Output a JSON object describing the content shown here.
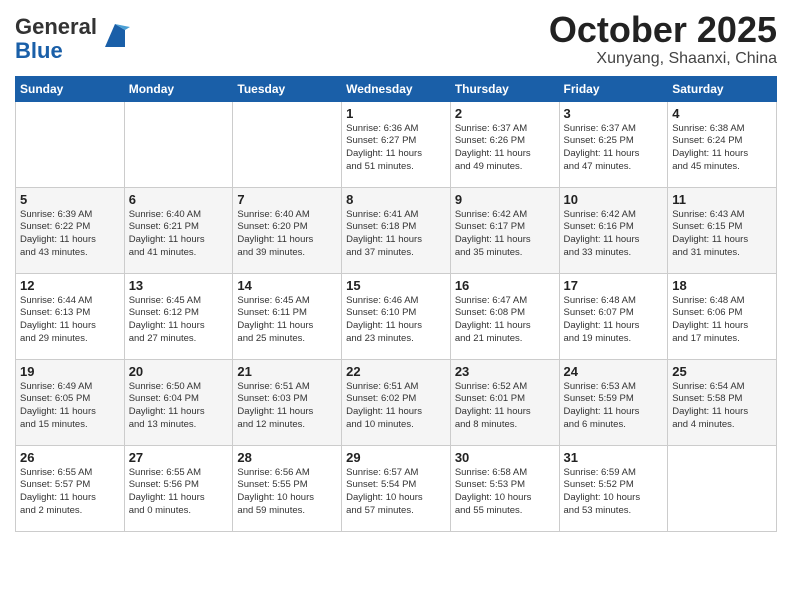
{
  "header": {
    "logo_general": "General",
    "logo_blue": "Blue",
    "month_title": "October 2025",
    "location": "Xunyang, Shaanxi, China"
  },
  "weekdays": [
    "Sunday",
    "Monday",
    "Tuesday",
    "Wednesday",
    "Thursday",
    "Friday",
    "Saturday"
  ],
  "weeks": [
    [
      {
        "day": "",
        "info": ""
      },
      {
        "day": "",
        "info": ""
      },
      {
        "day": "",
        "info": ""
      },
      {
        "day": "1",
        "info": "Sunrise: 6:36 AM\nSunset: 6:27 PM\nDaylight: 11 hours\nand 51 minutes."
      },
      {
        "day": "2",
        "info": "Sunrise: 6:37 AM\nSunset: 6:26 PM\nDaylight: 11 hours\nand 49 minutes."
      },
      {
        "day": "3",
        "info": "Sunrise: 6:37 AM\nSunset: 6:25 PM\nDaylight: 11 hours\nand 47 minutes."
      },
      {
        "day": "4",
        "info": "Sunrise: 6:38 AM\nSunset: 6:24 PM\nDaylight: 11 hours\nand 45 minutes."
      }
    ],
    [
      {
        "day": "5",
        "info": "Sunrise: 6:39 AM\nSunset: 6:22 PM\nDaylight: 11 hours\nand 43 minutes."
      },
      {
        "day": "6",
        "info": "Sunrise: 6:40 AM\nSunset: 6:21 PM\nDaylight: 11 hours\nand 41 minutes."
      },
      {
        "day": "7",
        "info": "Sunrise: 6:40 AM\nSunset: 6:20 PM\nDaylight: 11 hours\nand 39 minutes."
      },
      {
        "day": "8",
        "info": "Sunrise: 6:41 AM\nSunset: 6:18 PM\nDaylight: 11 hours\nand 37 minutes."
      },
      {
        "day": "9",
        "info": "Sunrise: 6:42 AM\nSunset: 6:17 PM\nDaylight: 11 hours\nand 35 minutes."
      },
      {
        "day": "10",
        "info": "Sunrise: 6:42 AM\nSunset: 6:16 PM\nDaylight: 11 hours\nand 33 minutes."
      },
      {
        "day": "11",
        "info": "Sunrise: 6:43 AM\nSunset: 6:15 PM\nDaylight: 11 hours\nand 31 minutes."
      }
    ],
    [
      {
        "day": "12",
        "info": "Sunrise: 6:44 AM\nSunset: 6:13 PM\nDaylight: 11 hours\nand 29 minutes."
      },
      {
        "day": "13",
        "info": "Sunrise: 6:45 AM\nSunset: 6:12 PM\nDaylight: 11 hours\nand 27 minutes."
      },
      {
        "day": "14",
        "info": "Sunrise: 6:45 AM\nSunset: 6:11 PM\nDaylight: 11 hours\nand 25 minutes."
      },
      {
        "day": "15",
        "info": "Sunrise: 6:46 AM\nSunset: 6:10 PM\nDaylight: 11 hours\nand 23 minutes."
      },
      {
        "day": "16",
        "info": "Sunrise: 6:47 AM\nSunset: 6:08 PM\nDaylight: 11 hours\nand 21 minutes."
      },
      {
        "day": "17",
        "info": "Sunrise: 6:48 AM\nSunset: 6:07 PM\nDaylight: 11 hours\nand 19 minutes."
      },
      {
        "day": "18",
        "info": "Sunrise: 6:48 AM\nSunset: 6:06 PM\nDaylight: 11 hours\nand 17 minutes."
      }
    ],
    [
      {
        "day": "19",
        "info": "Sunrise: 6:49 AM\nSunset: 6:05 PM\nDaylight: 11 hours\nand 15 minutes."
      },
      {
        "day": "20",
        "info": "Sunrise: 6:50 AM\nSunset: 6:04 PM\nDaylight: 11 hours\nand 13 minutes."
      },
      {
        "day": "21",
        "info": "Sunrise: 6:51 AM\nSunset: 6:03 PM\nDaylight: 11 hours\nand 12 minutes."
      },
      {
        "day": "22",
        "info": "Sunrise: 6:51 AM\nSunset: 6:02 PM\nDaylight: 11 hours\nand 10 minutes."
      },
      {
        "day": "23",
        "info": "Sunrise: 6:52 AM\nSunset: 6:01 PM\nDaylight: 11 hours\nand 8 minutes."
      },
      {
        "day": "24",
        "info": "Sunrise: 6:53 AM\nSunset: 5:59 PM\nDaylight: 11 hours\nand 6 minutes."
      },
      {
        "day": "25",
        "info": "Sunrise: 6:54 AM\nSunset: 5:58 PM\nDaylight: 11 hours\nand 4 minutes."
      }
    ],
    [
      {
        "day": "26",
        "info": "Sunrise: 6:55 AM\nSunset: 5:57 PM\nDaylight: 11 hours\nand 2 minutes."
      },
      {
        "day": "27",
        "info": "Sunrise: 6:55 AM\nSunset: 5:56 PM\nDaylight: 11 hours\nand 0 minutes."
      },
      {
        "day": "28",
        "info": "Sunrise: 6:56 AM\nSunset: 5:55 PM\nDaylight: 10 hours\nand 59 minutes."
      },
      {
        "day": "29",
        "info": "Sunrise: 6:57 AM\nSunset: 5:54 PM\nDaylight: 10 hours\nand 57 minutes."
      },
      {
        "day": "30",
        "info": "Sunrise: 6:58 AM\nSunset: 5:53 PM\nDaylight: 10 hours\nand 55 minutes."
      },
      {
        "day": "31",
        "info": "Sunrise: 6:59 AM\nSunset: 5:52 PM\nDaylight: 10 hours\nand 53 minutes."
      },
      {
        "day": "",
        "info": ""
      }
    ]
  ]
}
